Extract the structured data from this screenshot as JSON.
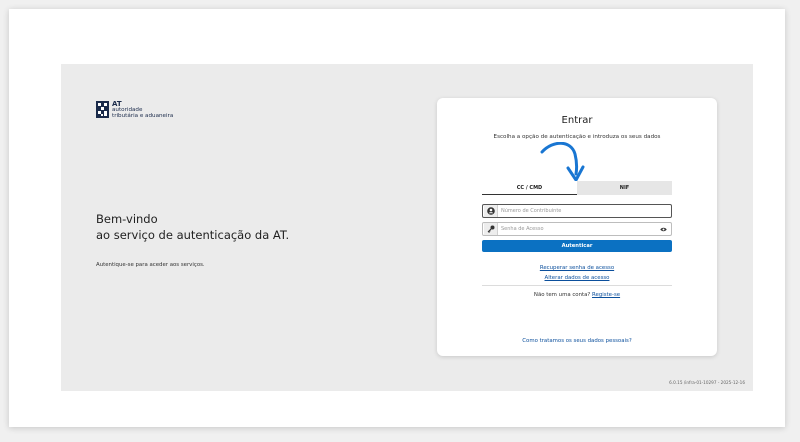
{
  "brand": {
    "logo_short": "AT",
    "logo_name_line1": "autoridade",
    "logo_name_line2": "tributária e aduaneira",
    "icon": "at-logo-icon",
    "color": "#1a2a4a"
  },
  "welcome": {
    "line1": "Bem-vindo",
    "line2": "ao serviço de autenticação da AT.",
    "subtext": "Autentique-se para aceder aos serviços."
  },
  "login": {
    "title": "Entrar",
    "subtitle": "Escolha a opção de autenticação e introduza os seus dados",
    "tabs": [
      {
        "label": "CC / CMD",
        "active": true
      },
      {
        "label": "NIF",
        "active": false
      }
    ],
    "nif_placeholder": "Número de Contribuinte",
    "password_placeholder": "Senha de Acesso",
    "nif_icon": "user-icon",
    "password_icon": "key-icon",
    "show_password_icon": "eye-icon",
    "submit_label": "Autenticar",
    "recover_link": "Recuperar senha de acesso",
    "change_link": "Alterar dados de acesso",
    "no_account_text": "Não tem uma conta?",
    "register_link": "Registe-se",
    "privacy_link": "Como tratamos os seus dados pessoais?",
    "annotation_icon": "curved-arrow-icon"
  },
  "footer": {
    "version": "6.0.15 /infra-01-10297 - 2025-12-16"
  },
  "colors": {
    "primary_button": "#0b71c2",
    "link": "#0b4f9c",
    "annotation_arrow": "#1976d2",
    "portal_background": "#ebebeb"
  }
}
